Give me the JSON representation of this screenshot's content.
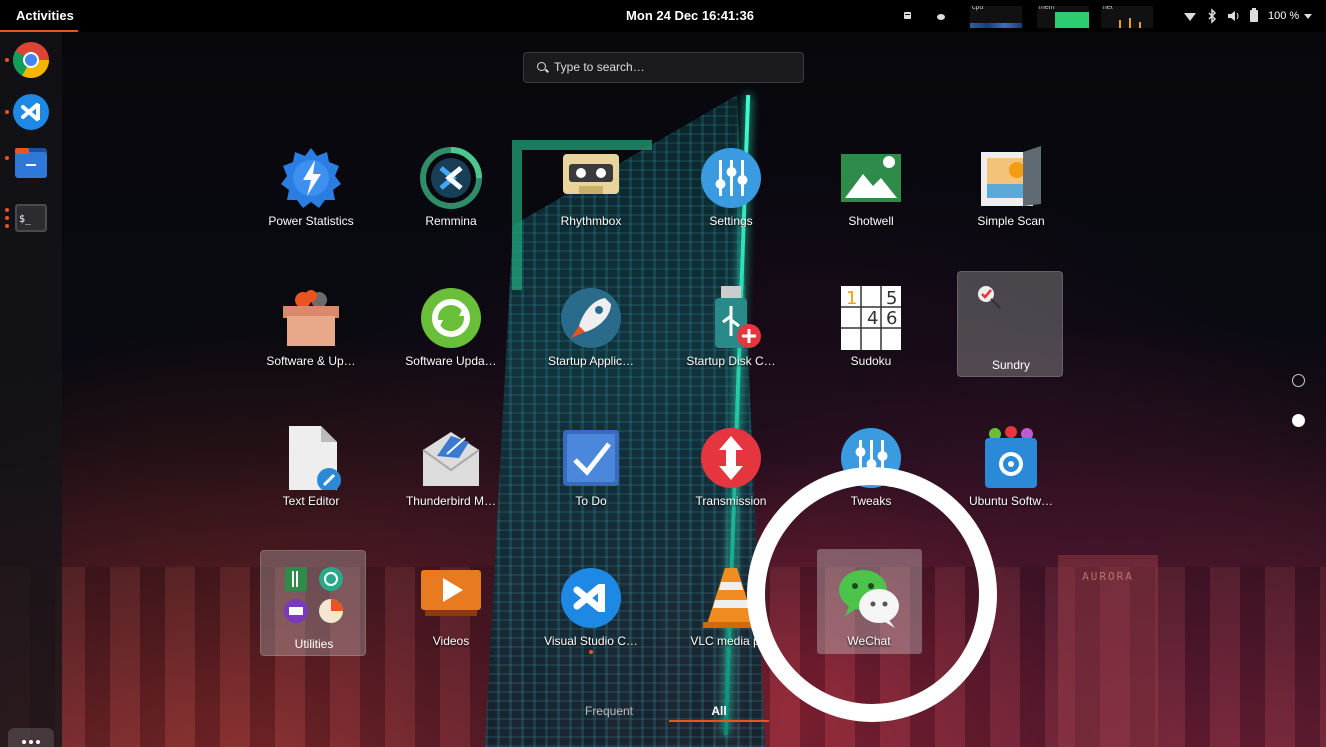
{
  "topbar": {
    "activities": "Activities",
    "clock": "Mon 24 Dec  16:41:36",
    "monitors": {
      "cpu": "cpu",
      "mem": "mem",
      "net": "net"
    },
    "battery": "100 %"
  },
  "search": {
    "placeholder": "Type to search…"
  },
  "apps": {
    "power_statistics": "Power Statistics",
    "remmina": "Remmina",
    "rhythmbox": "Rhythmbox",
    "settings": "Settings",
    "shotwell": "Shotwell",
    "simple_scan": "Simple Scan",
    "software_up": "Software & Up…",
    "software_upda": "Software Upda…",
    "startup_applic": "Startup Applic…",
    "startup_disk": "Startup Disk C…",
    "sudoku": "Sudoku",
    "sundry": "Sundry",
    "text_editor": "Text Editor",
    "thunderbird": "Thunderbird M…",
    "todo": "To Do",
    "transmission": "Transmission",
    "tweaks": "Tweaks",
    "ubuntu_software": "Ubuntu Softw…",
    "utilities": "Utilities",
    "videos": "Videos",
    "vscode": "Visual Studio C…",
    "vlc": "VLC media p…",
    "wechat": "WeChat"
  },
  "sudoku_digits": [
    "1",
    "5",
    "4",
    "6"
  ],
  "tabs": {
    "frequent": "Frequent",
    "all": "All"
  },
  "background_sign": "AURORA",
  "colors": {
    "accent": "#e95420"
  }
}
